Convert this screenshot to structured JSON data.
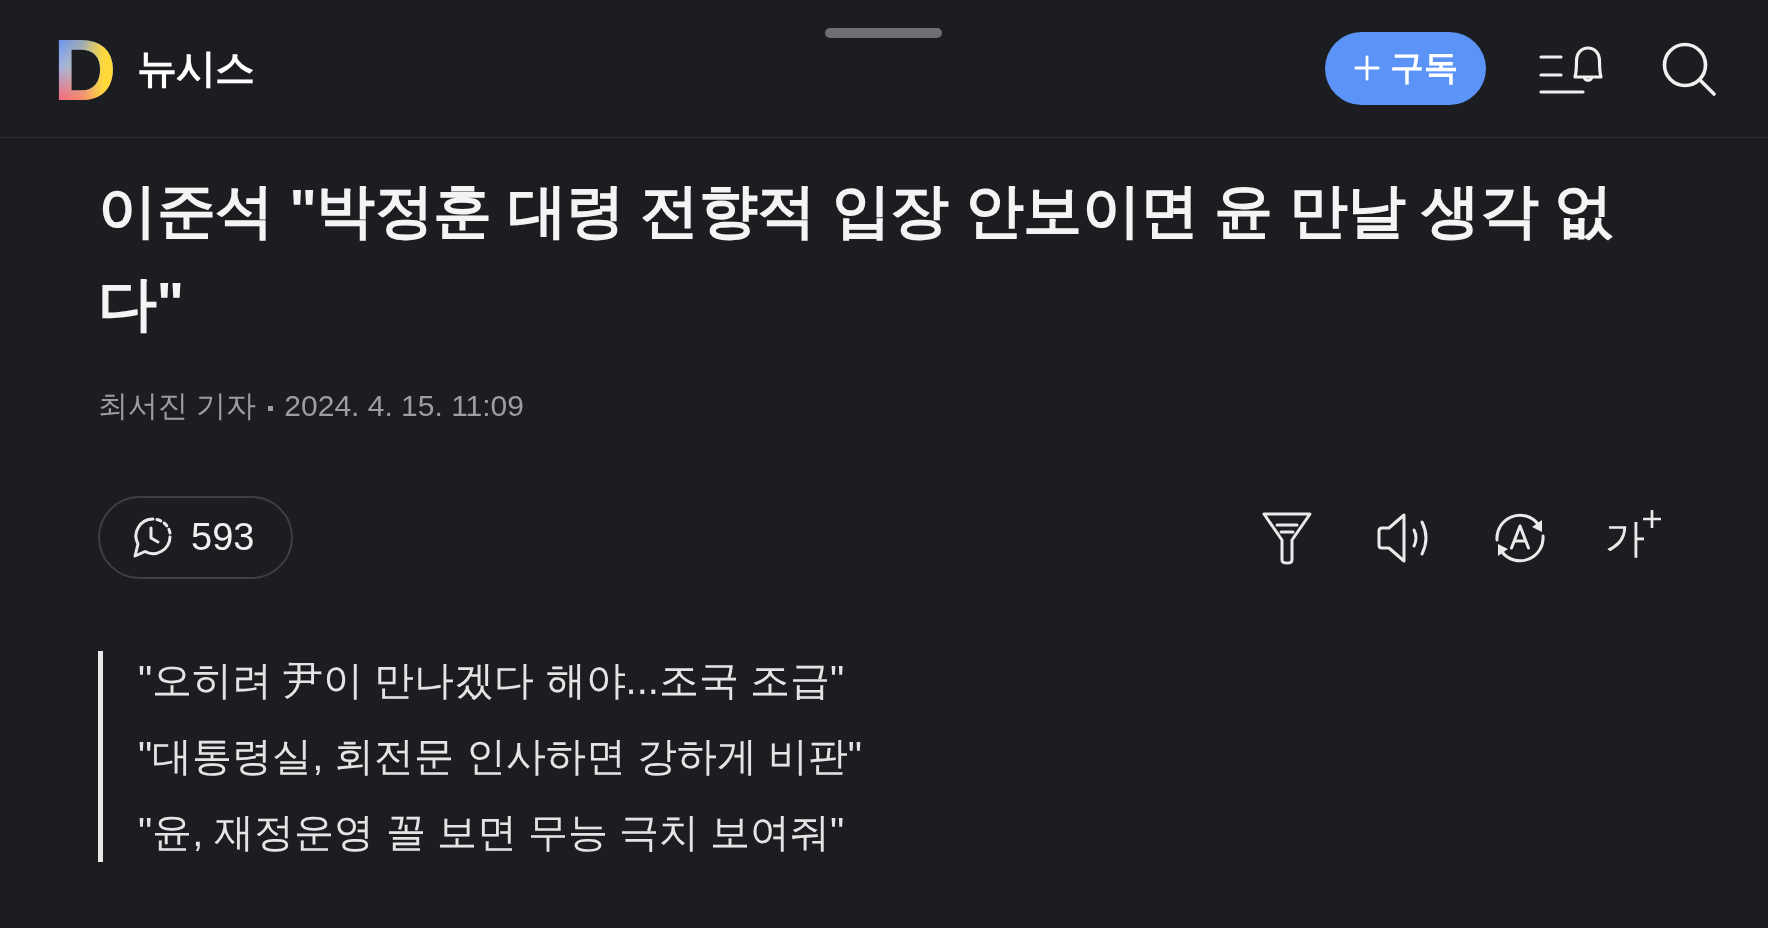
{
  "header": {
    "logo_mark": "D",
    "brand": "뉴시스",
    "subscribe_button": {
      "label": "구독"
    }
  },
  "article": {
    "title": "이준석 \"박정훈 대령 전향적 입장 안보이면 윤 만날 생각 없다\"",
    "byline": {
      "author": "최서진 기자",
      "date": "2024. 4. 15. 11:09"
    },
    "comment_count": "593",
    "font_size_button": {
      "label": "가"
    },
    "summary": [
      "\"오히려 尹이 만나겠다 해야...조국 조급\"",
      "\"대통령실, 회전문 인사하면 강하게 비판\"",
      "\"윤, 재정운영 꼴 보면 무능 극치 보여줘\""
    ]
  }
}
